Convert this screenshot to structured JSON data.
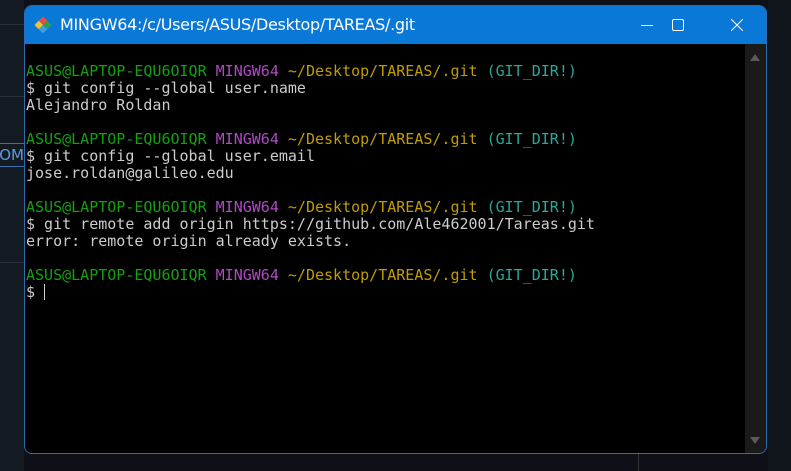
{
  "background": {
    "partial_text": "OM"
  },
  "window": {
    "title": "MINGW64:/c/Users/ASUS/Desktop/TAREAS/.git",
    "app_icon": "git-bash-icon",
    "controls": [
      "minimize-icon",
      "maximize-icon",
      "close-icon"
    ]
  },
  "colors": {
    "titlebar": "#0a78d7",
    "user_host": "#13a10e",
    "system": "#b148c6",
    "path": "#c19c00",
    "branch": "#2aa89a",
    "text": "#cccccc"
  },
  "terminal": {
    "blocks": [
      {
        "user_host": "ASUS@LAPTOP-EQU6OIQR",
        "system": "MINGW64",
        "path": "~/Desktop/TAREAS/.git",
        "branch": "(GIT_DIR!)",
        "command": "$ git config --global user.name",
        "output": "Alejandro Roldan"
      },
      {
        "user_host": "ASUS@LAPTOP-EQU6OIQR",
        "system": "MINGW64",
        "path": "~/Desktop/TAREAS/.git",
        "branch": "(GIT_DIR!)",
        "command": "$ git config --global user.email",
        "output": "jose.roldan@galileo.edu"
      },
      {
        "user_host": "ASUS@LAPTOP-EQU6OIQR",
        "system": "MINGW64",
        "path": "~/Desktop/TAREAS/.git",
        "branch": "(GIT_DIR!)",
        "command": "$ git remote add origin https://github.com/Ale462001/Tareas.git",
        "output": "error: remote origin already exists."
      },
      {
        "user_host": "ASUS@LAPTOP-EQU6OIQR",
        "system": "MINGW64",
        "path": "~/Desktop/TAREAS/.git",
        "branch": "(GIT_DIR!)",
        "command": "$ "
      }
    ]
  }
}
